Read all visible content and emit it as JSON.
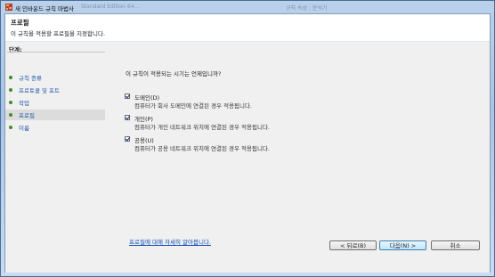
{
  "window": {
    "title": "새 인바운드 규칙 마법사",
    "background_tabs": [
      "Standard Edition 64...",
      "규칙 속성 : 분석기"
    ]
  },
  "header": {
    "title": "프로필",
    "subtitle": "이 규칙을 적용할 프로필을 지정합니다."
  },
  "sidebar": {
    "steps_label": "단계:",
    "items": [
      {
        "label": "규칙 종류"
      },
      {
        "label": "프로토콜 및 포트"
      },
      {
        "label": "작업"
      },
      {
        "label": "프로필"
      },
      {
        "label": "이름"
      }
    ]
  },
  "main": {
    "question": "이 규칙이 적용되는 시기는 언제입니까?",
    "options": [
      {
        "name": "도메인(D)",
        "desc": "컴퓨터가 회사 도메인에 연결된 경우 적용됩니다.",
        "checked": true
      },
      {
        "name": "개인(P)",
        "desc": "컴퓨터가 개인 네트워크 위치에 연결된 경우 적용됩니다.",
        "checked": true
      },
      {
        "name": "공용(U)",
        "desc": "컴퓨터가 공용 네트워크 위치에 연결된 경우 적용됩니다.",
        "checked": true
      }
    ],
    "learn_more": "프로필에 대해 자세히 알아봅니다."
  },
  "buttons": {
    "back": "< 뒤로(B)",
    "next": "다음(N) >",
    "cancel": "취소"
  },
  "colors": {
    "link": "#0e4fb8",
    "step_dot": "#3f8e2f",
    "active_step_bg": "#dcdcdc"
  }
}
